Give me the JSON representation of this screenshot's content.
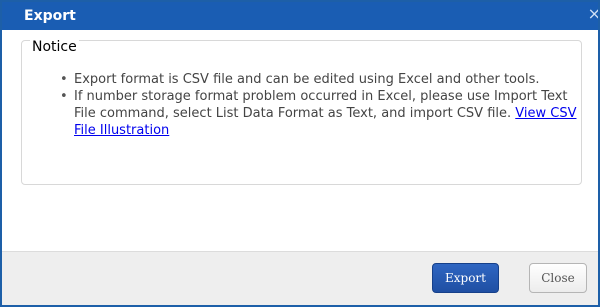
{
  "dialog": {
    "title": "Export",
    "close_glyph": "×"
  },
  "notice": {
    "legend": "Notice",
    "bullet1": "Export format is CSV file and can be edited using Excel and other tools.",
    "bullet2_text": "If number storage format problem occurred in Excel, please use Import Text File command, select List Data Format as Text, and import CSV file. ",
    "bullet2_link": "View CSV File Illustration"
  },
  "footer": {
    "export_label": "Export",
    "close_label": "Close"
  },
  "colors": {
    "titlebar": "#1a5db3",
    "border": "#1d5fa8",
    "export_button": "#1f4fa3",
    "link": "#0000ee"
  },
  "icons": {
    "close": "close-icon"
  }
}
